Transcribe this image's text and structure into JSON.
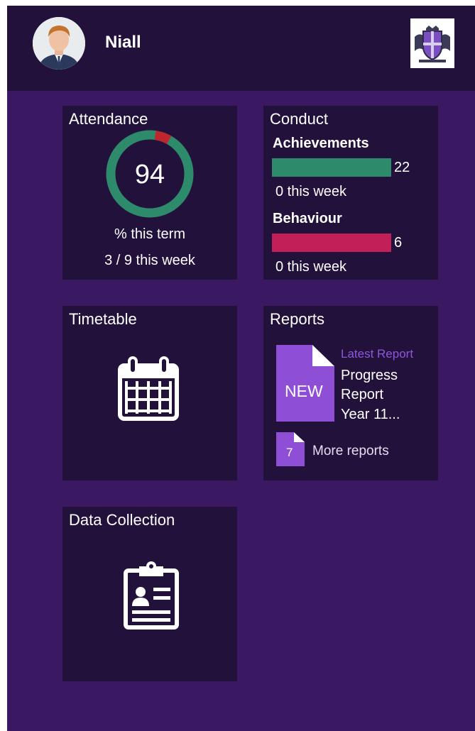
{
  "header": {
    "user_name": "Niall"
  },
  "attendance": {
    "title": "Attendance",
    "percent": 94,
    "percent_label": "% this term",
    "week_label": "3 / 9 this week",
    "ring_colors": {
      "present": "#2d8a6a",
      "absent": "#c0262e"
    }
  },
  "conduct": {
    "title": "Conduct",
    "achievements": {
      "label": "Achievements",
      "value": "22",
      "week": "0 this week",
      "color": "#2d8a6a"
    },
    "behaviour": {
      "label": "Behaviour",
      "value": "6",
      "week": "0 this week",
      "color": "#c01f57"
    }
  },
  "timetable": {
    "title": "Timetable",
    "icon": "calendar-icon"
  },
  "reports": {
    "title": "Reports",
    "new_label": "NEW",
    "latest_label": "Latest Report",
    "latest_lines": [
      "Progress",
      "Report",
      "Year 11..."
    ],
    "more_count": "7",
    "more_label": "More reports",
    "icon": "document-icon"
  },
  "data_collection": {
    "title": "Data Collection",
    "icon": "clipboard-icon"
  },
  "colors": {
    "background": "#3a1862",
    "tile": "#22123b",
    "header": "#22123b",
    "accent_purple": "#8e4fd6"
  }
}
